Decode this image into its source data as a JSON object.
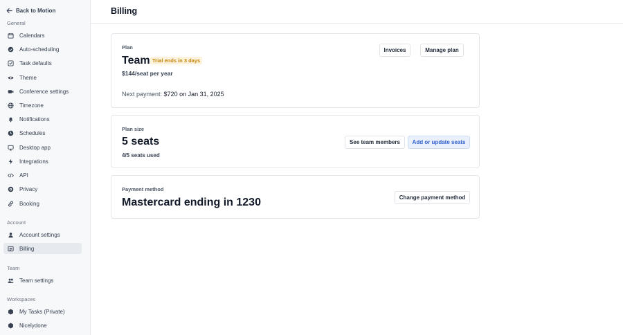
{
  "sidebar": {
    "back_label": "Back to Motion",
    "sections": {
      "general": "General",
      "account": "Account",
      "team": "Team",
      "workspaces": "Workspaces"
    },
    "general_items": [
      {
        "label": "Calendars",
        "icon": "calendar-icon"
      },
      {
        "label": "Auto-scheduling",
        "icon": "auto-scheduling-icon"
      },
      {
        "label": "Task defaults",
        "icon": "task-defaults-icon"
      },
      {
        "label": "Theme",
        "icon": "eye-icon"
      },
      {
        "label": "Conference settings",
        "icon": "video-icon"
      },
      {
        "label": "Timezone",
        "icon": "globe-icon"
      },
      {
        "label": "Notifications",
        "icon": "bell-icon"
      },
      {
        "label": "Schedules",
        "icon": "clock-icon"
      },
      {
        "label": "Desktop app",
        "icon": "monitor-icon"
      },
      {
        "label": "Integrations",
        "icon": "bolt-icon"
      },
      {
        "label": "API",
        "icon": "code-icon"
      },
      {
        "label": "Privacy",
        "icon": "shield-icon"
      },
      {
        "label": "Booking",
        "icon": "link-icon"
      }
    ],
    "account_items": [
      {
        "label": "Account settings",
        "icon": "user-icon"
      },
      {
        "label": "Billing",
        "icon": "billing-icon",
        "active": true
      }
    ],
    "team_items": [
      {
        "label": "Team settings",
        "icon": "team-icon"
      }
    ],
    "workspace_items": [
      {
        "label": "My Tasks (Private)",
        "icon": "workspace-icon"
      },
      {
        "label": "Nicelydone",
        "icon": "workspace-icon"
      }
    ]
  },
  "page": {
    "title": "Billing"
  },
  "plan_card": {
    "label": "Plan",
    "plan_name": "Team",
    "trial_badge": "Trial ends in 3 days",
    "price": "$144/seat per year",
    "next_payment_prefix": "Next payment:",
    "next_payment_value": "$720 on Jan 31, 2025",
    "invoices_button": "Invoices",
    "manage_plan_button": "Manage plan"
  },
  "size_card": {
    "label": "Plan size",
    "seats": "5 seats",
    "seats_used": "4/5 seats used",
    "see_members_button": "See team members",
    "add_seats_button": "Add or update seats"
  },
  "payment_card": {
    "label": "Payment method",
    "method": "Mastercard ending in 1230",
    "change_button": "Change payment method"
  },
  "colors": {
    "accent_blue": "#2f5fcf",
    "trial_badge_text": "#c2850c",
    "trial_badge_bg": "#fdf3dd"
  }
}
